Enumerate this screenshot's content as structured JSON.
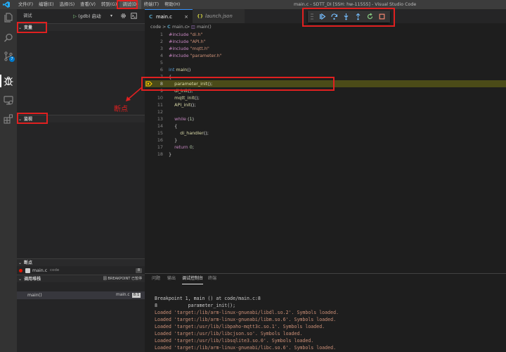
{
  "titlebar": {
    "menu": [
      "文件(F)",
      "编辑(E)",
      "选择(S)",
      "查看(V)",
      "转到(G)",
      "调试(D)",
      "终端(T)",
      "帮助(H)"
    ],
    "active_menu_index": 5,
    "window_title": "main.c - SDTT_DI [SSH: hw-11555] - Visual Studio Code"
  },
  "activity": {
    "items": [
      "explorer-icon",
      "search-icon",
      "source-control-icon",
      "debug-icon",
      "remote-explorer-icon",
      "extensions-icon"
    ],
    "scm_badge": "7"
  },
  "sidebar": {
    "title": "调试",
    "run_config": "(gdb) 启动",
    "sections": {
      "variables": "变量",
      "watch": "监视",
      "breakpoints": "断点",
      "call_stack": "调用堆栈"
    },
    "breakpoint": {
      "file": "main.c",
      "dir": "code",
      "line": "8"
    },
    "call_stack_extra": "因 BREAKPOINT 已暂停",
    "frame": {
      "fn": "main()",
      "file": "main.c",
      "line": "8:1"
    }
  },
  "editor": {
    "tabs": [
      {
        "label": "main.c",
        "icon": "C"
      },
      {
        "label": "launch.json",
        "icon": "{}"
      }
    ],
    "breadcrumb": [
      "code",
      ">",
      "C",
      "main.c",
      ">",
      "main()"
    ],
    "current_line": 8
  },
  "annotation": {
    "label": "断点"
  },
  "panel": {
    "tabs": [
      "问题",
      "输出",
      "调试控制台",
      "终端"
    ],
    "active_tab_index": 2,
    "lines": [
      "Breakpoint 1, main () at code/main.c:8",
      "8           parameter_init();",
      "Loaded 'target:/lib/arm-linux-gnueabi/libdl.so.2'. Symbols loaded.",
      "Loaded 'target:/lib/arm-linux-gnueabi/libm.so.6'. Symbols loaded.",
      "Loaded 'target:/usr/lib/libpaho-mqtt3c.so.1'. Symbols loaded.",
      "Loaded 'target:/usr/lib/libcjson.so'. Symbols loaded.",
      "Loaded 'target:/usr/lib/libsqlite3.so.0'. Symbols loaded.",
      "Loaded 'target:/lib/arm-linux-gnueabi/libc.so.6'. Symbols loaded."
    ]
  },
  "colors": {
    "accent": "#007acc",
    "highlight_box": "#e02020",
    "current_line": "#4b4b18",
    "continue": "#75beff",
    "restart": "#89d185",
    "stop": "#f48771"
  }
}
